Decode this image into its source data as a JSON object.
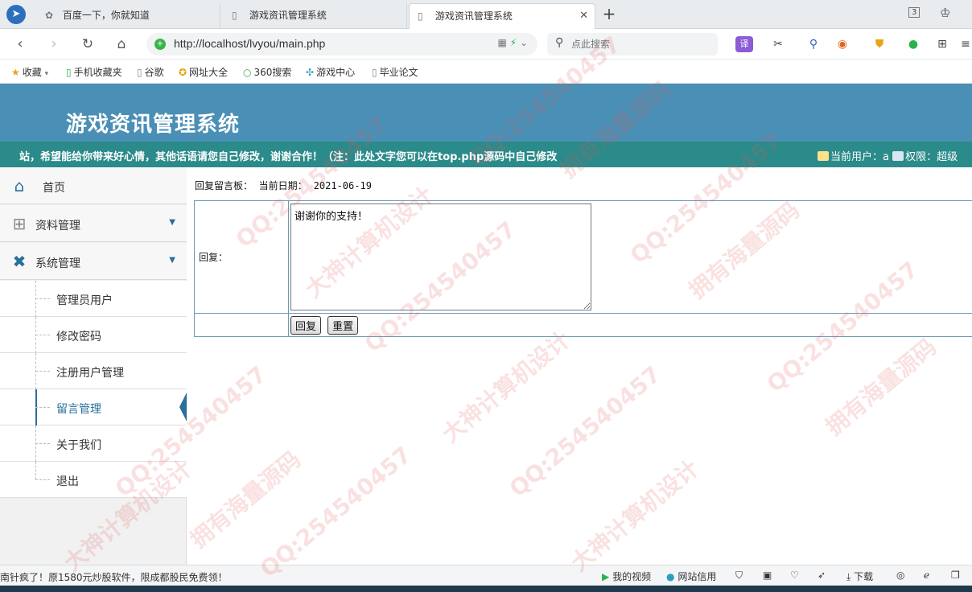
{
  "browser": {
    "tabs": [
      {
        "title": "百度一下，你就知道",
        "active": false
      },
      {
        "title": "游戏资讯管理系统",
        "active": false
      },
      {
        "title": "游戏资讯管理系统",
        "active": true
      }
    ],
    "tab_count": "3",
    "address": "http://localhost/lvyou/main.php",
    "search_placeholder": "点此搜索",
    "ext_translate": "译",
    "bookmarks": [
      "收藏",
      "手机收藏夹",
      "谷歌",
      "网址大全",
      "360搜索",
      "游戏中心",
      "毕业论文"
    ]
  },
  "app": {
    "title": "游戏资讯管理系统",
    "marquee": "站，希望能给你带来好心情，其他话语请您自己修改，谢谢合作！（注：此处文字您可以在top.php源码中自己修改",
    "current_user": "当前用户：a",
    "permission": "权限：超级"
  },
  "sidebar": {
    "home": "首页",
    "data_mgmt": "资料管理",
    "sys_mgmt": "系统管理",
    "sub_items": [
      "管理员用户",
      "修改密码",
      "注册用户管理",
      "留言管理",
      "关于我们",
      "退出"
    ],
    "active_sub": "留言管理"
  },
  "content": {
    "crumb_label": "回复留言板：",
    "date_label": "当前日期：",
    "date_value": "2021-06-19",
    "reply_label": "回复：",
    "reply_value": "谢谢你的支持！",
    "submit_label": "回复",
    "reset_label": "重置"
  },
  "statusbar": {
    "ad": "南针疯了！原1580元炒股软件，限成都股民免费领！",
    "my_video": "我的视频",
    "net_credit": "网站信用",
    "download": "下载"
  },
  "watermarks": [
    "QQ:254540457",
    "大神计算机设计",
    "拥有海量源码"
  ],
  "colors": {
    "header": "#4a8fb5",
    "marquee_bar": "#2b8a8a",
    "accent": "#2a6f9b"
  }
}
